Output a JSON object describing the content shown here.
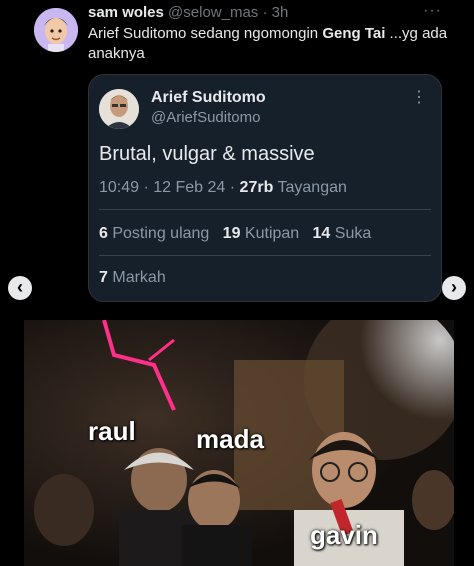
{
  "tweet": {
    "display_name": "sam woles",
    "handle": "@selow_mas",
    "time": "3h",
    "more": "···",
    "text_part1": "Arief Suditomo sedang ngomongin ",
    "text_bold": "Geng Tai",
    "text_part2": " ...yg ada anaknya"
  },
  "quote": {
    "display_name": "Arief Suditomo",
    "handle": "@AriefSuditomo",
    "text": "Brutal, vulgar & massive",
    "time": "10:49",
    "date": "12 Feb 24",
    "views_count": "27rb",
    "views_label": "Tayangan",
    "reposts_count": "6",
    "reposts_label": "Posting ulang",
    "quotes_count": "19",
    "quotes_label": "Kutipan",
    "likes_count": "14",
    "likes_label": "Suka",
    "bookmarks_count": "7",
    "bookmarks_label": "Markah"
  },
  "nav": {
    "prev": "‹",
    "next": "›"
  },
  "media": {
    "captions": [
      "raul",
      "mada",
      "gavin"
    ]
  }
}
